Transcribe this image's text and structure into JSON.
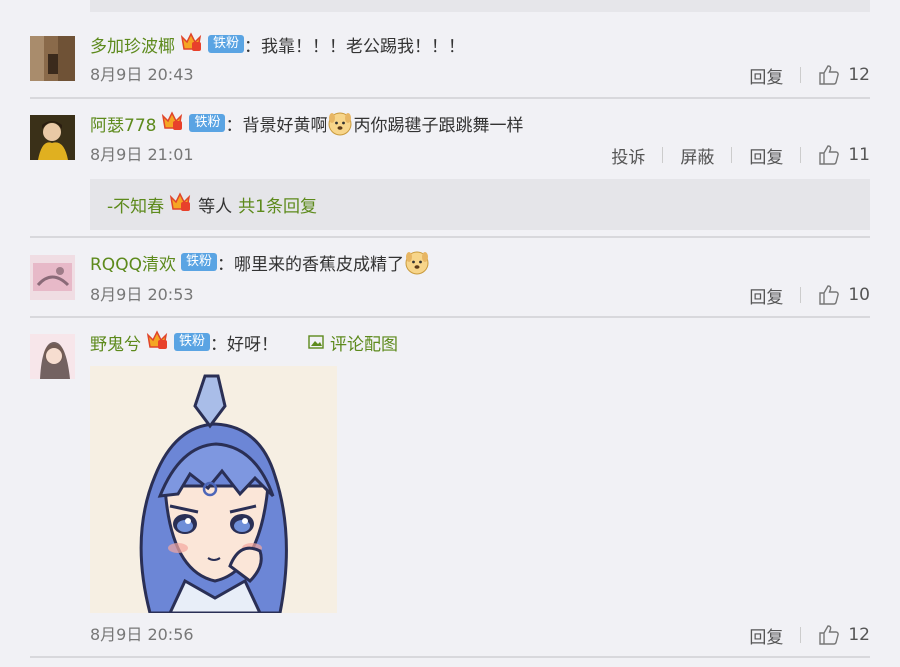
{
  "comments": [
    {
      "username": "多加珍波椰",
      "badge": "铁粉",
      "text": "：我靠！！！老公踢我！！！",
      "time": "8月9日 20:43",
      "reply": "回复",
      "likes": "12"
    },
    {
      "username": "阿瑟778",
      "badge": "铁粉",
      "text_before": "：背景好黄啊",
      "text_after": "丙你踢毽子跟跳舞一样",
      "time": "8月9日 21:01",
      "report": "投诉",
      "block": "屏蔽",
      "reply": "回复",
      "likes": "11",
      "subreply": {
        "user": "-不知春",
        "mid": "等人",
        "more": "共1条回复"
      }
    },
    {
      "username": "RQQQ清欢",
      "badge": "铁粉",
      "text": "：哪里来的香蕉皮成精了",
      "time": "8月9日 20:53",
      "reply": "回复",
      "likes": "10"
    },
    {
      "username": "野鬼兮",
      "badge": "铁粉",
      "text": "：好呀！",
      "pic_label": "评论配图",
      "time": "8月9日 20:56",
      "reply": "回复",
      "likes": "12"
    }
  ],
  "colors": {
    "background": "#f1f1f5",
    "username": "#5d8a1c",
    "badge": "#5aa4e3",
    "box": "#e5e5e9"
  },
  "icons": [
    "vip-crown-icon",
    "emoji-dog-icon",
    "like-thumb-icon",
    "image-icon"
  ]
}
